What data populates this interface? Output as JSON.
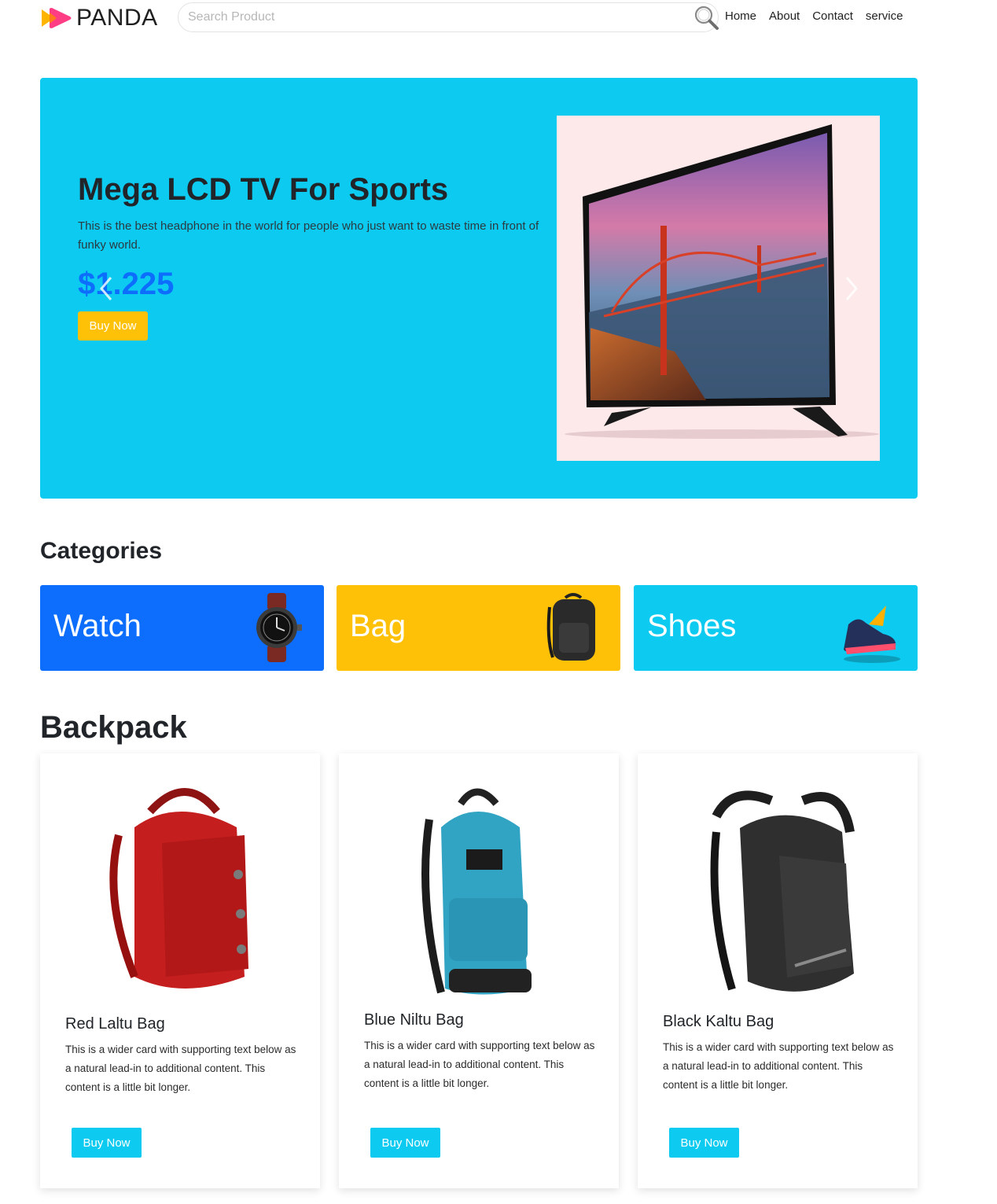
{
  "header": {
    "brand": "PANDA",
    "search_placeholder": "Search Product",
    "nav": [
      "Home",
      "About",
      "Contact",
      "service"
    ]
  },
  "hero": {
    "title": "Mega LCD TV For Sports",
    "description": "This is the best headphone in the world for people who just want to waste time in front of funky world.",
    "price": "$1.225",
    "button_label": "Buy Now"
  },
  "categories": {
    "heading": "Categories",
    "items": [
      {
        "label": "Watch",
        "color": "#0d6efd"
      },
      {
        "label": "Bag",
        "color": "#ffc107"
      },
      {
        "label": "Shoes",
        "color": "#0dcaf0"
      }
    ]
  },
  "backpack": {
    "heading": "Backpack",
    "cards": [
      {
        "title": "Red Laltu Bag",
        "text": "This is a wider card with supporting text below as a natural lead-in to additional content. This content is a little bit longer.",
        "button_label": "Buy Now"
      },
      {
        "title": "Blue Niltu Bag",
        "text": "This is a wider card with supporting text below as a natural lead-in to additional content. This content is a little bit longer.",
        "button_label": "Buy Now"
      },
      {
        "title": "Black Kaltu Bag",
        "text": "This is a wider card with supporting text below as a natural lead-in to additional content. This content is a little bit longer.",
        "button_label": "Buy Now"
      }
    ]
  },
  "colors": {
    "primary": "#0d6efd",
    "warning": "#ffc107",
    "info": "#0dcaf0",
    "hero_bg": "#0dcaf0"
  }
}
